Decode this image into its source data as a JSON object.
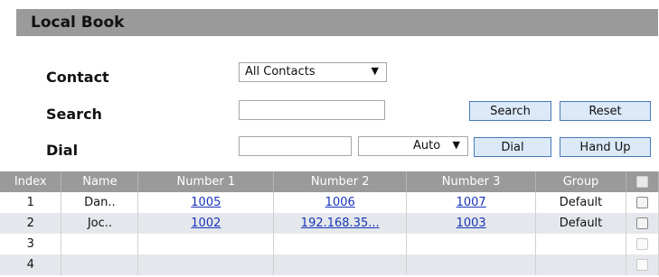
{
  "header": {
    "title": "Local Book"
  },
  "contact": {
    "label": "Contact",
    "selected": "All Contacts"
  },
  "search": {
    "label": "Search",
    "value": "",
    "search_button": "Search",
    "reset_button": "Reset"
  },
  "dial": {
    "label": "Dial",
    "value": "",
    "line_selected": "Auto",
    "dial_button": "Dial",
    "hangup_button": "Hand Up"
  },
  "table": {
    "columns": [
      "Index",
      "Name",
      "Number 1",
      "Number 2",
      "Number 3",
      "Group"
    ],
    "rows": [
      {
        "index": "1",
        "name": "Dan..",
        "number1": "1005",
        "number2": "1006",
        "number3": "1007",
        "group": "Default"
      },
      {
        "index": "2",
        "name": "Joc..",
        "number1": "1002",
        "number2": "192.168.35...",
        "number3": "1003",
        "group": "Default"
      },
      {
        "index": "3",
        "name": "",
        "number1": "",
        "number2": "",
        "number3": "",
        "group": ""
      },
      {
        "index": "4",
        "name": "",
        "number1": "",
        "number2": "",
        "number3": "",
        "group": ""
      }
    ]
  },
  "colors": {
    "header_bg": "#9a9a9a",
    "row_alt": "#e4e8ec",
    "link": "#1a33b8",
    "button_bg": "#dbe9f8",
    "button_border": "#4a78b8"
  },
  "icons": {
    "dropdown": "chevron-down-icon",
    "checkbox": "checkbox-icon"
  }
}
